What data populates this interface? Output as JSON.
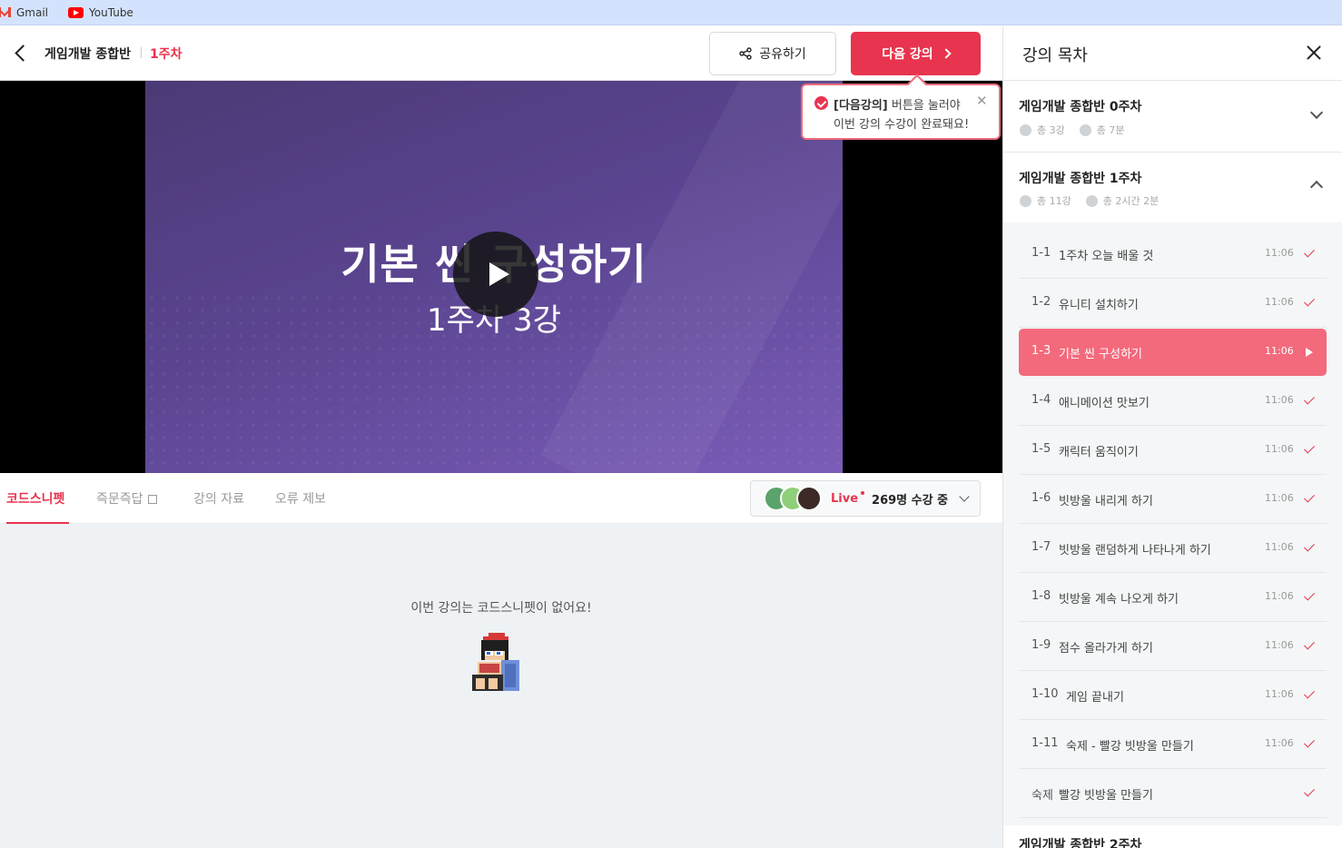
{
  "bookmarks": [
    {
      "label": "Gmail",
      "icon": "gmail-icon"
    },
    {
      "label": "YouTube",
      "icon": "youtube-icon"
    }
  ],
  "header": {
    "course_title": "게임개발 종합반",
    "week": "1주차",
    "share_label": "공유하기",
    "next_label": "다음 강의"
  },
  "video": {
    "title": "기본 씬 구성하기",
    "subtitle": "1주차 3강"
  },
  "tooltip": {
    "highlight": "[다음강의]",
    "line1_rest": " 버튼을 눌러야",
    "line2": "이번 강의 수강이 완료돼요!"
  },
  "tabs": [
    {
      "label": "코드스니펫",
      "active": true
    },
    {
      "label": "즉문즉답",
      "active": false,
      "external": true
    },
    {
      "label": "강의 자료",
      "active": false
    },
    {
      "label": "오류 제보",
      "active": false
    }
  ],
  "live": {
    "label": "Live",
    "count_text": "269명 수강 중"
  },
  "content": {
    "empty_message": "이번 강의는 코드스니펫이 없어요!"
  },
  "sidebar": {
    "title": "강의 목차",
    "weeks": [
      {
        "name": "게임개발 종합반 0주차",
        "count": "총 3강",
        "duration": "총 7분",
        "expanded": false
      },
      {
        "name": "게임개발 종합반 1주차",
        "count": "총 11강",
        "duration": "총 2시간 2분",
        "expanded": true
      }
    ],
    "lessons": [
      {
        "num": "1-1",
        "title": "1주차 오늘 배울 것",
        "time": "11:06",
        "done": true
      },
      {
        "num": "1-2",
        "title": "유니티 설치하기",
        "time": "11:06",
        "done": true
      },
      {
        "num": "1-3",
        "title": "기본 씬 구성하기",
        "time": "11:06",
        "current": true
      },
      {
        "num": "1-4",
        "title": "애니메이션 맛보기",
        "time": "11:06",
        "done": true
      },
      {
        "num": "1-5",
        "title": "캐릭터 움직이기",
        "time": "11:06",
        "done": true
      },
      {
        "num": "1-6",
        "title": "빗방울 내리게 하기",
        "time": "11:06",
        "done": true
      },
      {
        "num": "1-7",
        "title": "빗방울 랜덤하게 나타나게 하기",
        "time": "11:06",
        "done": true
      },
      {
        "num": "1-8",
        "title": "빗방울 계속 나오게 하기",
        "time": "11:06",
        "done": true
      },
      {
        "num": "1-9",
        "title": "점수 올라가게 하기",
        "time": "11:06",
        "done": true
      },
      {
        "num": "1-10",
        "title": "게임 끝내기",
        "time": "11:06",
        "done": true
      },
      {
        "num": "1-11",
        "title": "숙제 - 빨강 빗방울 만들기",
        "time": "11:06",
        "done": true
      },
      {
        "num": "숙제",
        "title": "빨강 빗방울 만들기",
        "time": "",
        "done": true
      }
    ],
    "next_week_peek": "게임개발 종합반 2주차"
  },
  "colors": {
    "accent": "#e8344e",
    "current_lesson": "#f36a7c",
    "video_bg": "#5a4490",
    "content_bg": "#eef2f4"
  }
}
